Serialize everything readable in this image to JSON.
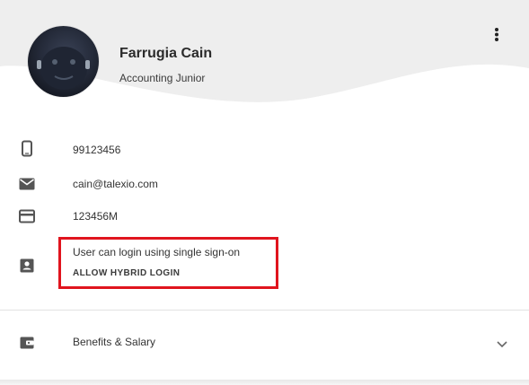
{
  "profile": {
    "name": "Farrugia Cain",
    "role": "Accounting Junior"
  },
  "details": {
    "phone": "99123456",
    "email": "cain@talexio.com",
    "id_card": "123456M"
  },
  "login": {
    "sso_text": "User can login using single sign-on",
    "hybrid_label": "ALLOW HYBRID LOGIN"
  },
  "sections": {
    "benefits_label": "Benefits & Salary"
  },
  "icons": {
    "more": "more-vertical-icon",
    "phone": "phone-icon",
    "email": "email-icon",
    "card": "credit-card-icon",
    "badge": "contact-badge-icon",
    "wallet": "wallet-icon",
    "expand": "chevron-down-icon"
  },
  "colors": {
    "highlight_border": "#e0141e",
    "icon": "#555555",
    "header_bg": "#eeeeee"
  }
}
